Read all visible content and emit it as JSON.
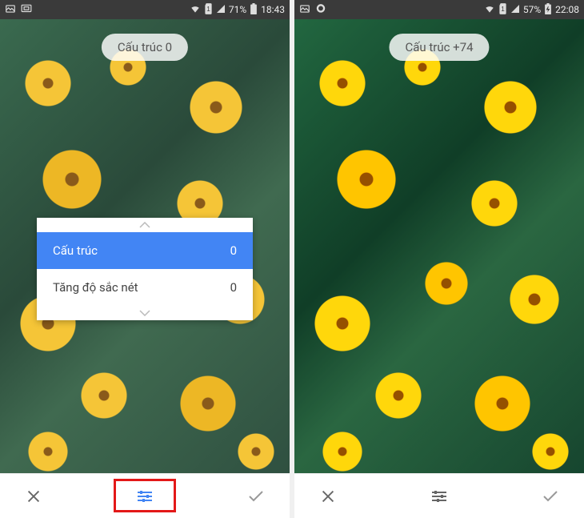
{
  "screens": [
    {
      "statusbar": {
        "left_icons": [
          "image-icon",
          "cast-icon"
        ],
        "wifi": true,
        "sim": "1",
        "signal": true,
        "battery_pct": "71%",
        "time": "18:43"
      },
      "pill_label": "Cấu trúc 0",
      "panel": {
        "rows": [
          {
            "label": "Cấu trúc",
            "value": "0",
            "selected": true
          },
          {
            "label": "Tăng độ sắc nét",
            "value": "0",
            "selected": false
          }
        ]
      },
      "bottom": {
        "close": "×",
        "adjust_active": true,
        "confirm": "✓",
        "highlight": true
      }
    },
    {
      "statusbar": {
        "left_icons": [
          "image-icon",
          "messenger-icon"
        ],
        "wifi": true,
        "sim": "1",
        "signal": true,
        "battery_pct": "57%",
        "charging": true,
        "time": "22:08"
      },
      "pill_label": "Cấu trúc +74",
      "panel": null,
      "bottom": {
        "close": "×",
        "adjust_active": false,
        "confirm": "✓",
        "highlight": false
      }
    }
  ]
}
